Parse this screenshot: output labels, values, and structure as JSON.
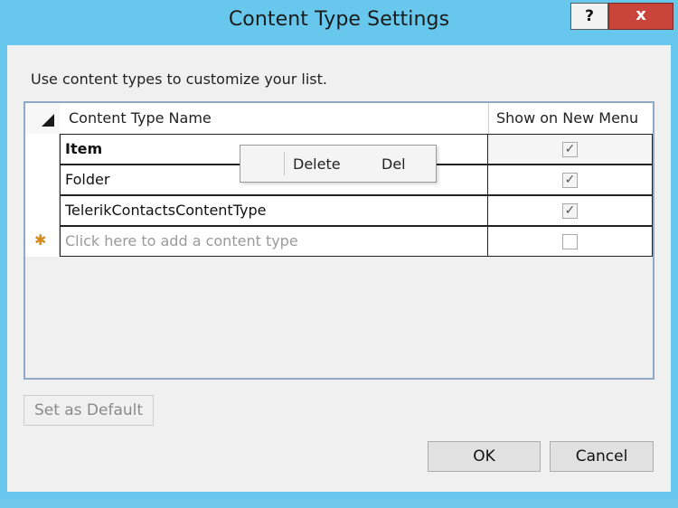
{
  "window": {
    "title": "Content Type Settings",
    "help_label": "?",
    "close_label": "x"
  },
  "instructions": "Use content types to customize your list.",
  "grid": {
    "columns": [
      "Content Type Name",
      "Show on New Menu"
    ],
    "rows": [
      {
        "name": "Item",
        "show_on_new_menu": true
      },
      {
        "name": "Folder",
        "show_on_new_menu": true
      },
      {
        "name": "TelerikContactsContentType",
        "show_on_new_menu": true
      }
    ],
    "new_row_placeholder": "Click here to add a content type",
    "new_row_marker": "✱"
  },
  "context_menu": {
    "items": [
      {
        "label": "Delete",
        "shortcut": "Del"
      }
    ]
  },
  "buttons": {
    "set_default": "Set as Default",
    "ok": "OK",
    "cancel": "Cancel"
  }
}
